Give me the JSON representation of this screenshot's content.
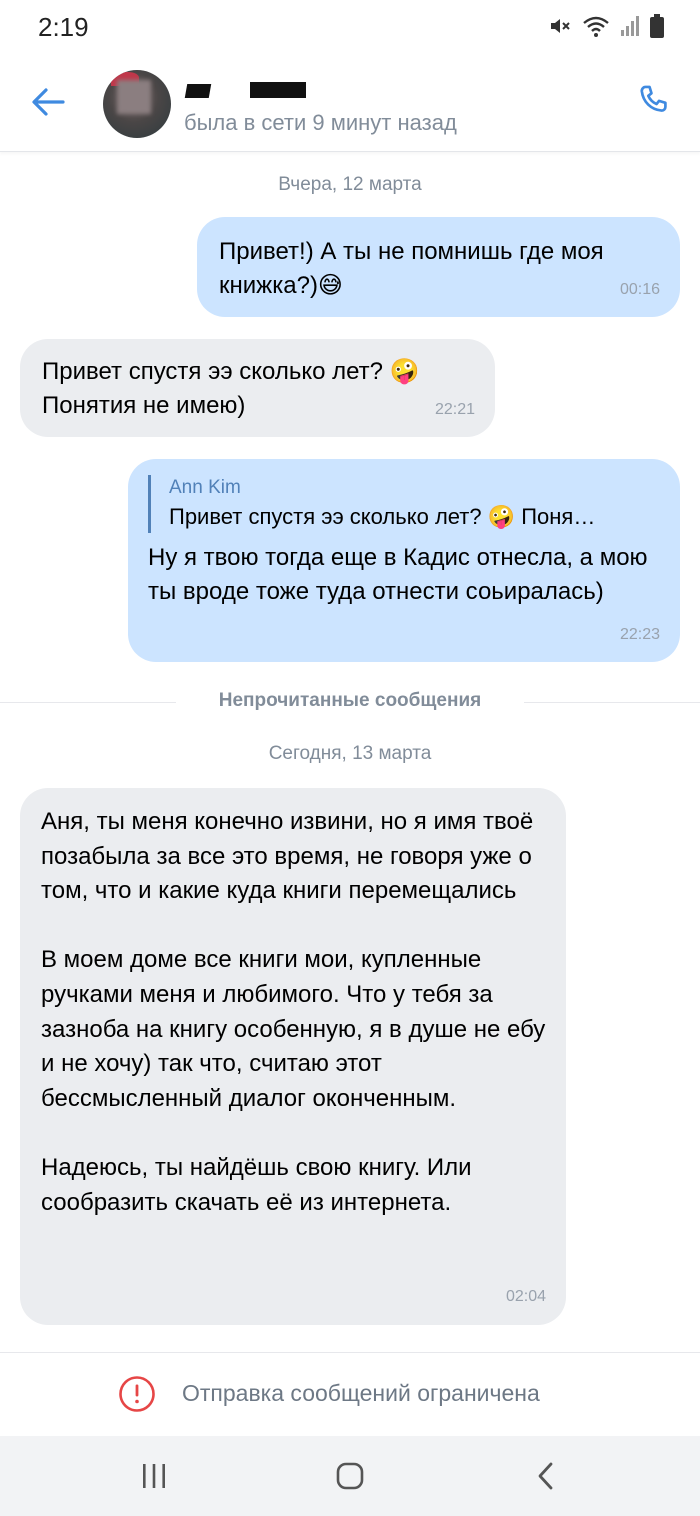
{
  "status_bar": {
    "time": "2:19",
    "icons": [
      "mute-icon",
      "wifi-icon",
      "signal-icon",
      "battery-icon"
    ]
  },
  "header": {
    "back_icon": "arrow-left-icon",
    "contact_status": "была в сети 9 минут назад",
    "call_icon": "phone-icon"
  },
  "messages": {
    "date_yesterday": "Вчера, 12 марта",
    "msg1": {
      "text": "Привет!) А ты не помнишь где моя книжка?)😅",
      "time": "00:16"
    },
    "msg2": {
      "text": "Привет спустя ээ сколько лет? 🤪\nПонятия не имею)",
      "time": "22:21"
    },
    "msg3": {
      "reply_author": "Ann Kim",
      "reply_text": "Привет спустя ээ сколько лет? 🤪 Поня…",
      "text": "Ну я твою тогда еще в Кадис отнесла, а мою ты вроде тоже туда отнести соьиралась)",
      "time": "22:23"
    },
    "unread_label": "Непрочитанные сообщения",
    "date_today": "Сегодня, 13 марта",
    "msg4": {
      "text": "Аня, ты меня конечно извини, но я имя твоё позабыла за все это время, не говоря уже о том, что и какие куда книги перемещались\n\nВ моем доме все книги мои, купленные ручками меня и любимого. Что у тебя за зазноба на книгу особенную, я в душе не ебу и не хочу) так что, считаю этот бессмысленный диалог оконченным.\n\nНадеюсь, ты найдёшь свою книгу. Или сообразить скачать её из интернета.",
      "time": "02:04"
    }
  },
  "footer": {
    "restricted_text": "Отправка сообщений ограничена",
    "restricted_icon": "exclamation-circle-icon"
  },
  "nav_bar": {
    "buttons": [
      "recent-apps-icon",
      "home-icon",
      "back-icon"
    ]
  },
  "colors": {
    "accent": "#5181b8",
    "outgoing_bubble": "#cce4ff",
    "incoming_bubble": "#ebedf0",
    "warning": "#e64646"
  }
}
